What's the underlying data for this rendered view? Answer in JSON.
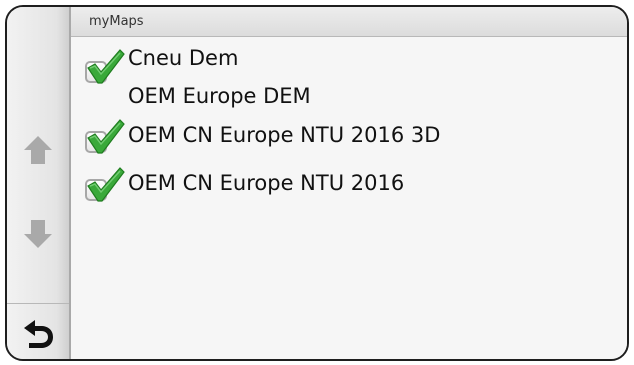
{
  "header": {
    "title": "myMaps"
  },
  "maps": [
    {
      "line1": "Cneu Dem",
      "line2": "OEM Europe DEM",
      "checked": true
    },
    {
      "line1": "OEM CN Europe NTU 2016 3D",
      "checked": true
    },
    {
      "line1": "OEM CN Europe NTU 2016",
      "checked": true
    }
  ],
  "rail": {
    "up_icon": "arrow-up-icon",
    "down_icon": "arrow-down-icon",
    "back_icon": "back-icon"
  },
  "colors": {
    "check_green": "#3aa93a",
    "arrow_gray": "#a8a8a8",
    "back_black": "#111111"
  }
}
